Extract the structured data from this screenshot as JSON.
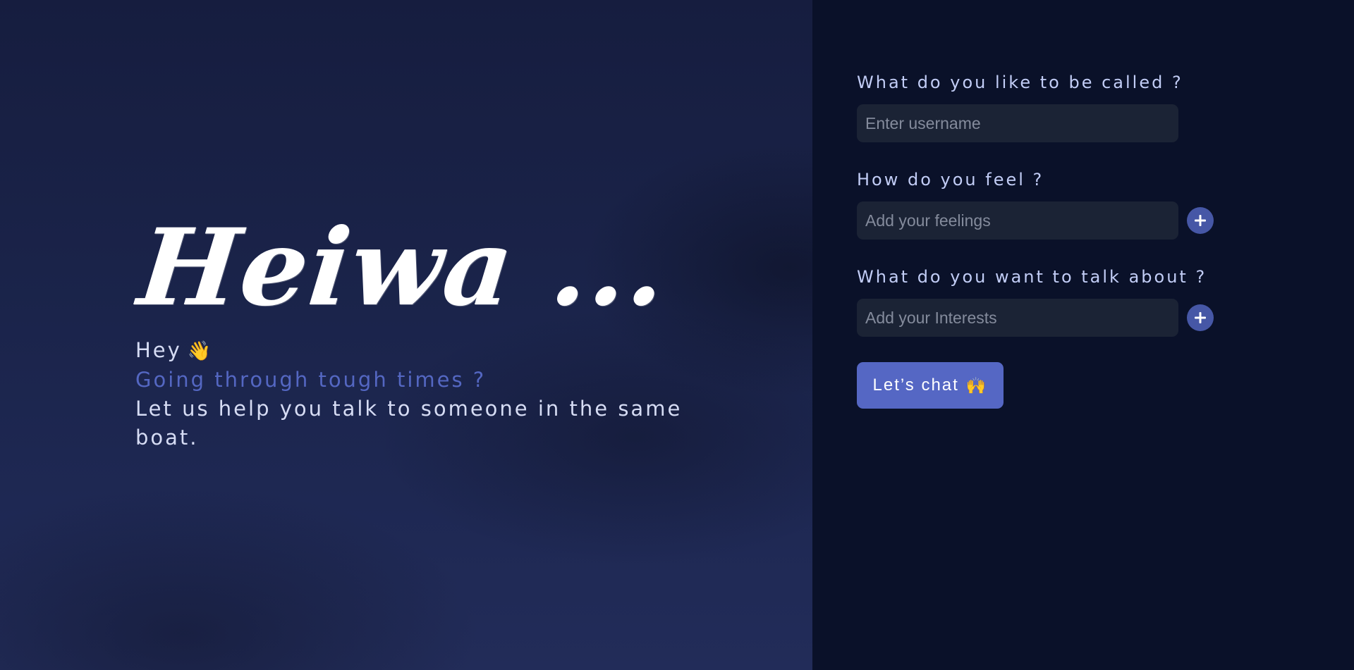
{
  "hero": {
    "brand": "Heiwa ...",
    "greeting": "Hey",
    "greeting_emoji": "👋",
    "question": "Going through tough times ?",
    "message": "Let us help you talk to someone in the same boat."
  },
  "form": {
    "username": {
      "label": "What do you like to be called ?",
      "placeholder": "Enter username",
      "value": ""
    },
    "feelings": {
      "label": "How do you feel ?",
      "placeholder": "Add your feelings",
      "value": "",
      "add_icon": "plus-icon"
    },
    "interests": {
      "label": "What do you want to talk about ?",
      "placeholder": "Add your Interests",
      "value": "",
      "add_icon": "plus-icon"
    },
    "submit": {
      "label": "Let’s chat",
      "emoji": "🙌"
    }
  },
  "colors": {
    "accent": "#5567c4",
    "accent_text": "#5467c2",
    "panel_bg": "#0a1129",
    "input_bg": "#1b2335",
    "label": "#c2cdf6"
  }
}
